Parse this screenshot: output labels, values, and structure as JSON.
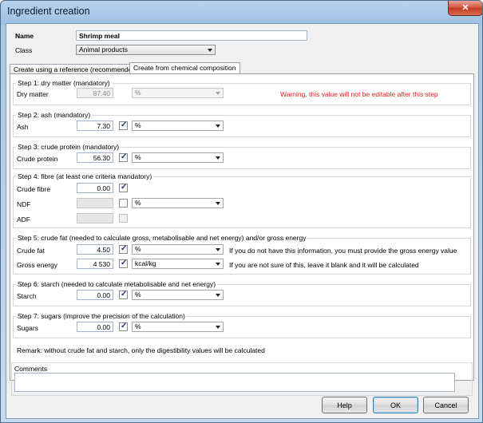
{
  "window": {
    "title": "Ingredient creation",
    "close_glyph": "✕"
  },
  "header": {
    "name_label": "Name",
    "name_value": "Shrimp meal",
    "class_label": "Class",
    "class_value": "Animal products"
  },
  "tabs": [
    {
      "label": "Create using a reference (recommended)",
      "active": false
    },
    {
      "label": "Create from chemical composition",
      "active": true
    }
  ],
  "step1": {
    "title": "Step 1: dry matter (mandatory)",
    "field_label": "Dry matter",
    "value": "87.40",
    "unit": "%",
    "warning": "Warning, this value will not be editable after this step"
  },
  "step2": {
    "title": "Step 2: ash (mandatory)",
    "field_label": "Ash",
    "value": "7.30",
    "checked": true,
    "unit": "%"
  },
  "step3": {
    "title": "Step 3: crude protein (mandatory)",
    "field_label": "Crude protein",
    "value": "56.30",
    "checked": true,
    "unit": "%"
  },
  "step4": {
    "title": "Step 4: fibre (at least one criteria mandatory)",
    "crude_fibre": {
      "label": "Crude fibre",
      "value": "0.00",
      "checked": true
    },
    "ndf": {
      "label": "NDF",
      "value": "",
      "checked": false,
      "unit": "%"
    },
    "adf": {
      "label": "ADF",
      "value": "",
      "checked": false
    }
  },
  "step5": {
    "title": "Step 5: crude fat (needed to calculate gross, metabolisable and net energy) and/or gross energy",
    "crude_fat": {
      "label": "Crude fat",
      "value": "4.50",
      "checked": true,
      "unit": "%",
      "hint": "If you do not have this information, you must provide the gross energy value"
    },
    "gross_energy": {
      "label": "Gross energy",
      "value": "4 530",
      "checked": true,
      "unit": "kcal/kg",
      "hint": "If you are not sure of this, leave it blank and it will be calculated"
    }
  },
  "step6": {
    "title": "Step 6: starch (needed to calculate metabolisable and net energy)",
    "field_label": "Starch",
    "value": "0.00",
    "checked": true,
    "unit": "%"
  },
  "step7": {
    "title": "Step 7: sugars (improve the precision of the calculation)",
    "field_label": "Sugars",
    "value": "0.00",
    "checked": true,
    "unit": "%"
  },
  "remark": "Remark: without crude fat and starch, only the digestibility values will be calculated",
  "comments": {
    "label": "Comments",
    "value": ""
  },
  "buttons": {
    "help": "Help",
    "ok": "OK",
    "cancel": "Cancel"
  },
  "icons": {
    "checkbox_tick": "✓",
    "dropdown": "chevron-down-icon"
  }
}
